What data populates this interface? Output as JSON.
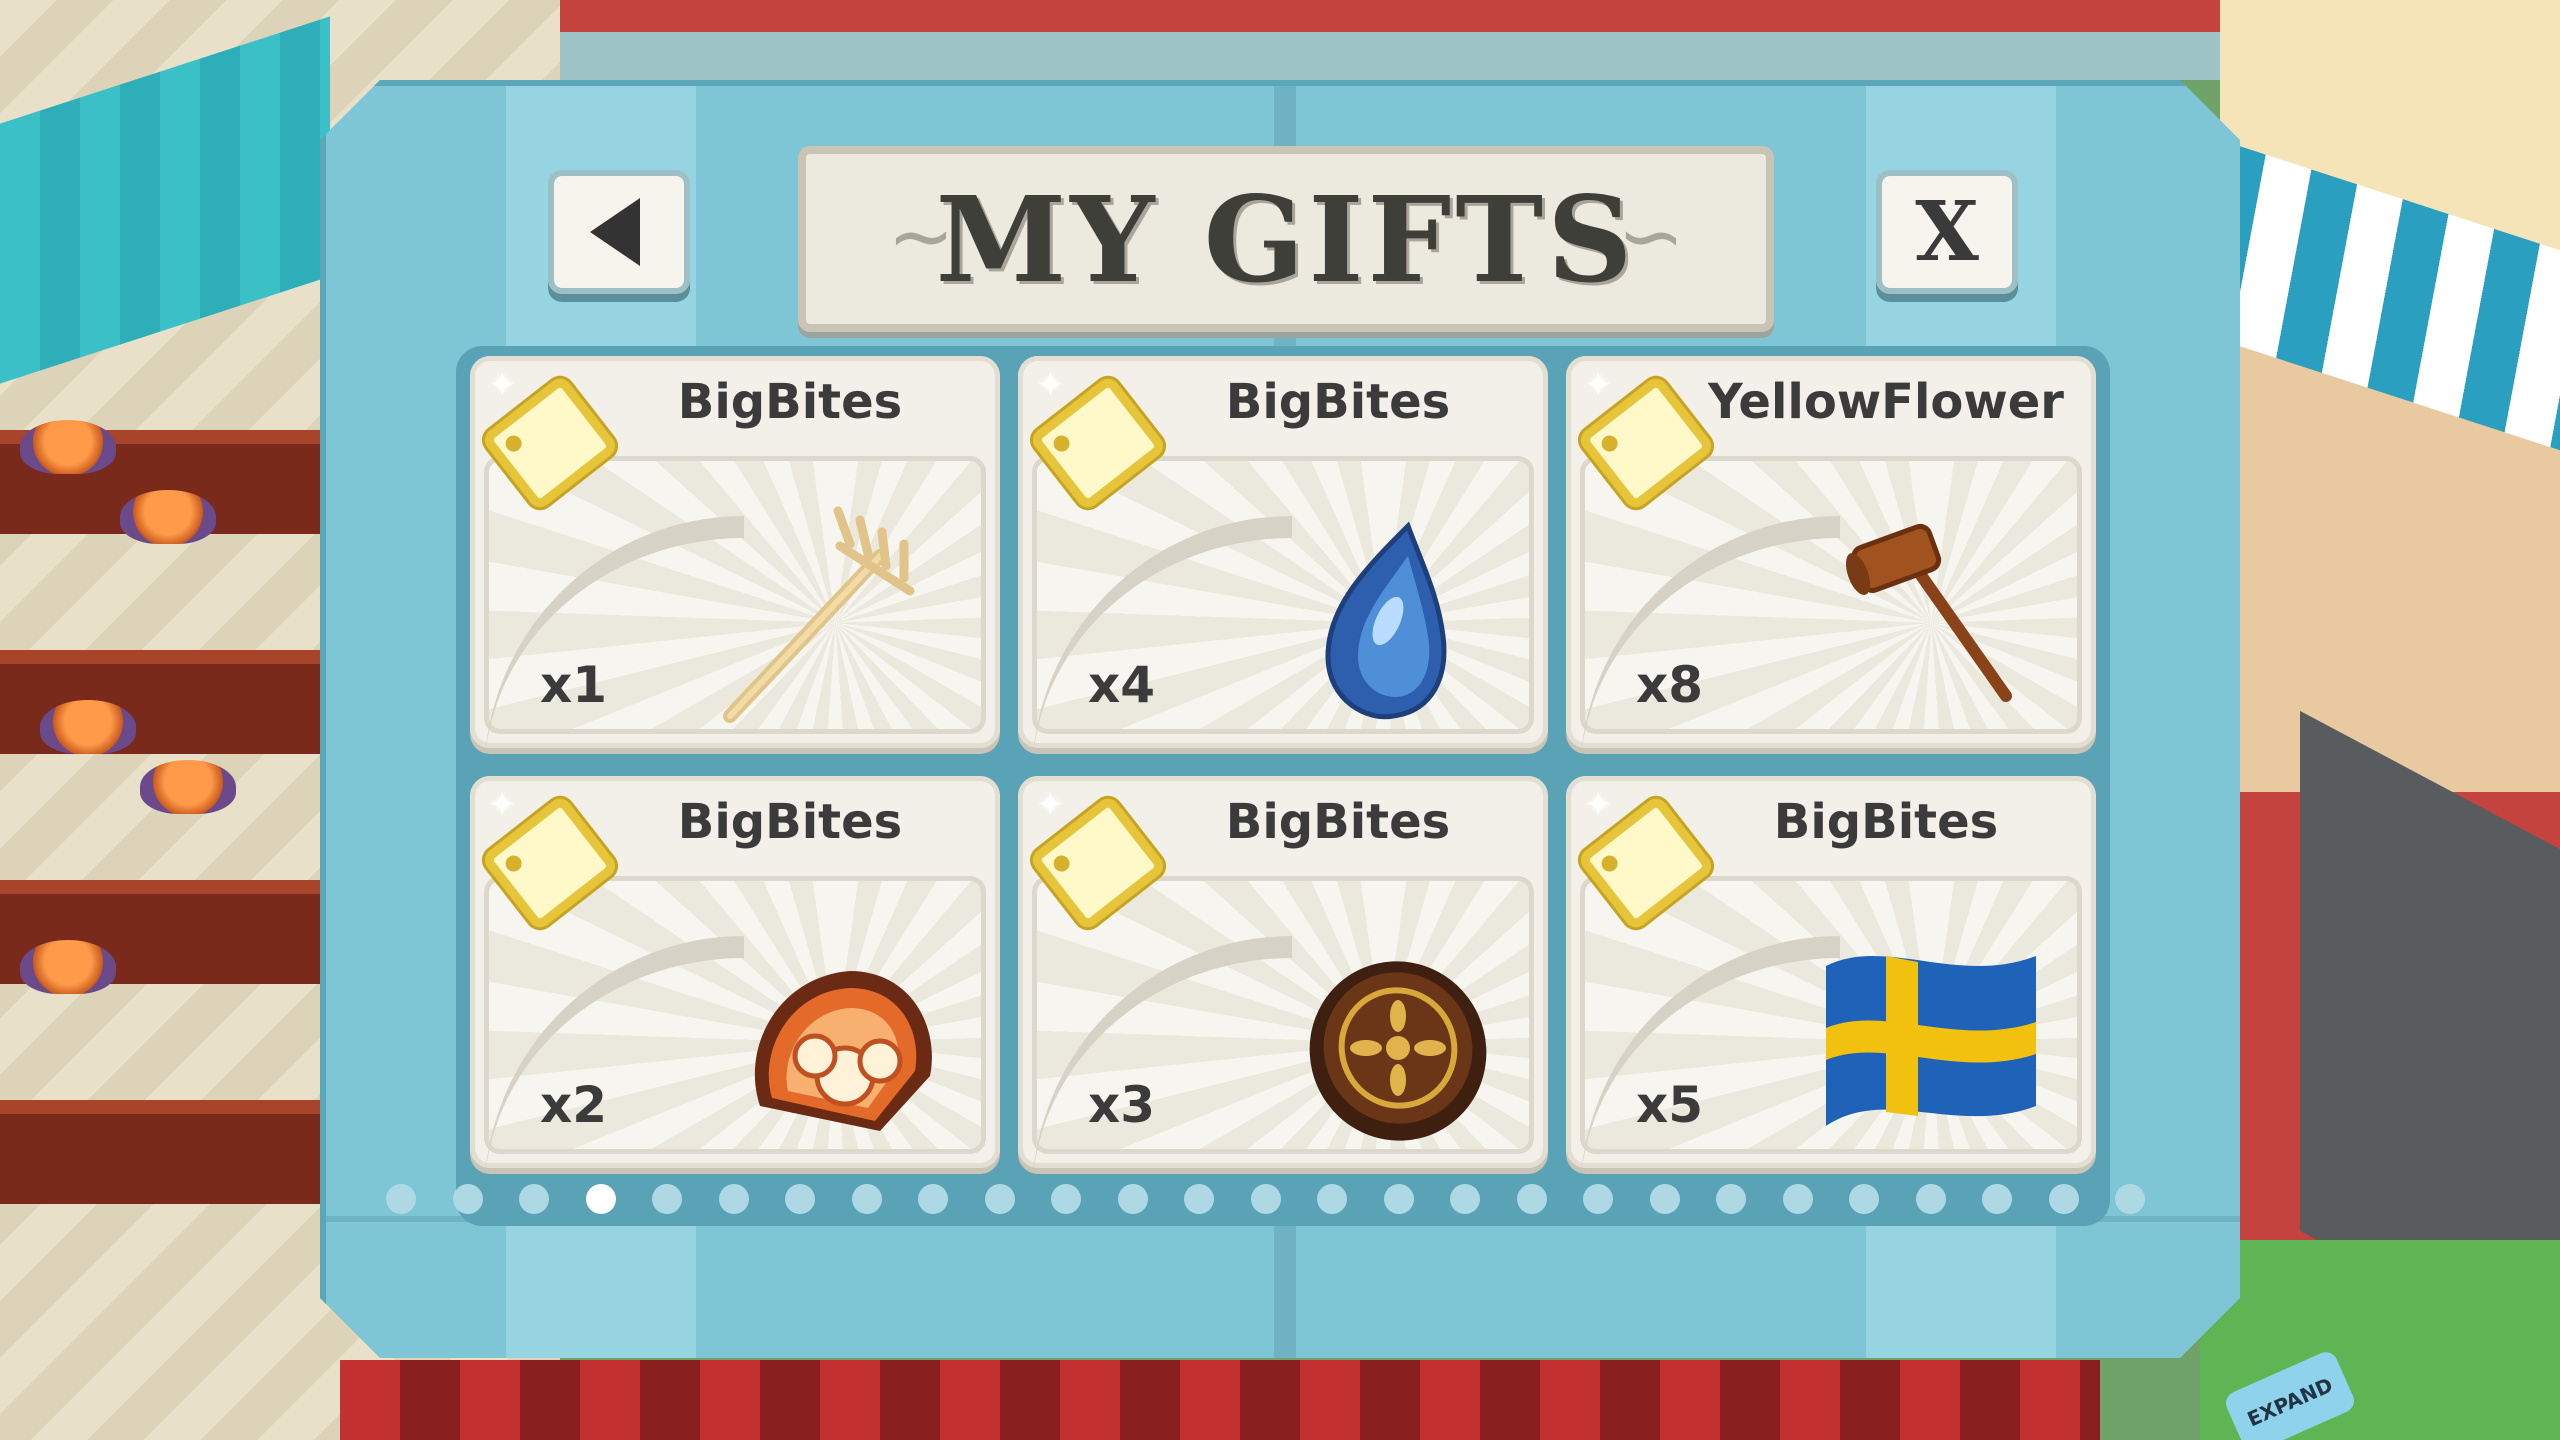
{
  "dialog": {
    "title": "MY GIFTS",
    "back_icon": "left-triangle-arrow",
    "close_label": "X"
  },
  "gifts": [
    {
      "sender": "BigBites",
      "quantity": "x1",
      "item": "rake"
    },
    {
      "sender": "BigBites",
      "quantity": "x4",
      "item": "blue-droplet"
    },
    {
      "sender": "YellowFlower",
      "quantity": "x8",
      "item": "mallet"
    },
    {
      "sender": "BigBites",
      "quantity": "x2",
      "item": "turkey-tail"
    },
    {
      "sender": "BigBites",
      "quantity": "x3",
      "item": "chocolate-tart"
    },
    {
      "sender": "BigBites",
      "quantity": "x5",
      "item": "swedish-flag"
    }
  ],
  "pagination": {
    "total_pages": 27,
    "current_page": 4
  },
  "scene": {
    "expand_label": "EXPAND"
  },
  "colors": {
    "dialog_bg": "#7ec6d6",
    "tag_yellow": "#e7c53a",
    "text_dark": "#3b3b3b",
    "dot_active": "#ffffff",
    "dot_inactive": "#aed9e4"
  }
}
